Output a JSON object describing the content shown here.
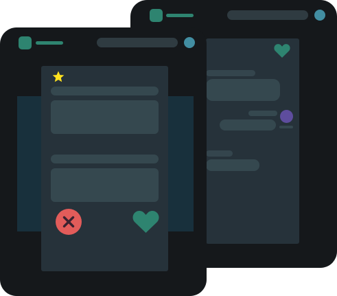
{
  "colors": {
    "window_bg": "#15181b",
    "panel_bg": "#26323a",
    "side_card_bg": "#18303c",
    "placeholder": "#35484f",
    "placeholder_dark": "#303f46",
    "accent_green": "#2e8470",
    "accent_blue": "#428ea2",
    "accent_purple": "#5e4d9e",
    "star_yellow": "#ffe21f",
    "reject_red": "#e25c5a",
    "reject_x": "#3a2230"
  },
  "back_window": {
    "logo_icon": "app-logo-icon",
    "avatar_icon": "avatar-icon",
    "heart_icon": "heart-icon"
  },
  "front_window": {
    "logo_icon": "app-logo-icon",
    "avatar_icon": "avatar-icon",
    "favorite_icon": "star-icon",
    "reject_icon": "close-icon",
    "like_icon": "heart-icon"
  }
}
